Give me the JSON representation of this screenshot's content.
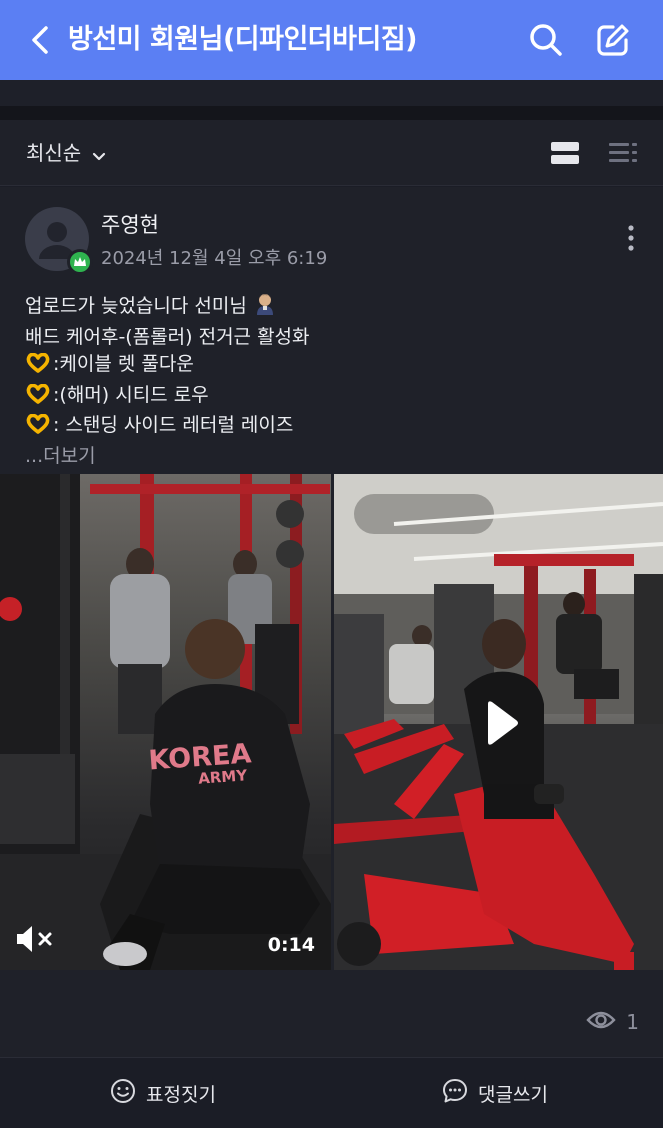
{
  "header": {
    "title": "방선미 회원님(디파인더바디짐)",
    "bg_color": "#5b7ff3",
    "back_icon": "chevron-left-icon",
    "search_icon": "search-icon",
    "edit_icon": "edit-icon"
  },
  "sort": {
    "label": "최신순",
    "icon": "chevron-down-icon",
    "views": [
      "card-view-icon",
      "list-view-icon"
    ]
  },
  "post": {
    "author": "주영현",
    "date": "2024년 12월 4일 오후 6:19",
    "lines": [
      "업로드가 늦었습니다 선미님",
      "배드 케어후-(폼롤러) 전거근 활성화",
      ":케이블 렛 풀다운",
      ":(해머) 시티드 로우",
      ": 스탠딩 사이드 레터럴 레이즈"
    ],
    "more_label": "...더보기",
    "media": [
      {
        "type": "video",
        "duration": "0:14",
        "muted": true,
        "shirt_text_1": "KOREA",
        "shirt_text_2": "ARMY"
      },
      {
        "type": "video",
        "play_icon": "play-icon"
      }
    ],
    "view_count": "1"
  },
  "bottom": {
    "emoji_label": "표정짓기",
    "comment_label": "댓글쓰기"
  }
}
